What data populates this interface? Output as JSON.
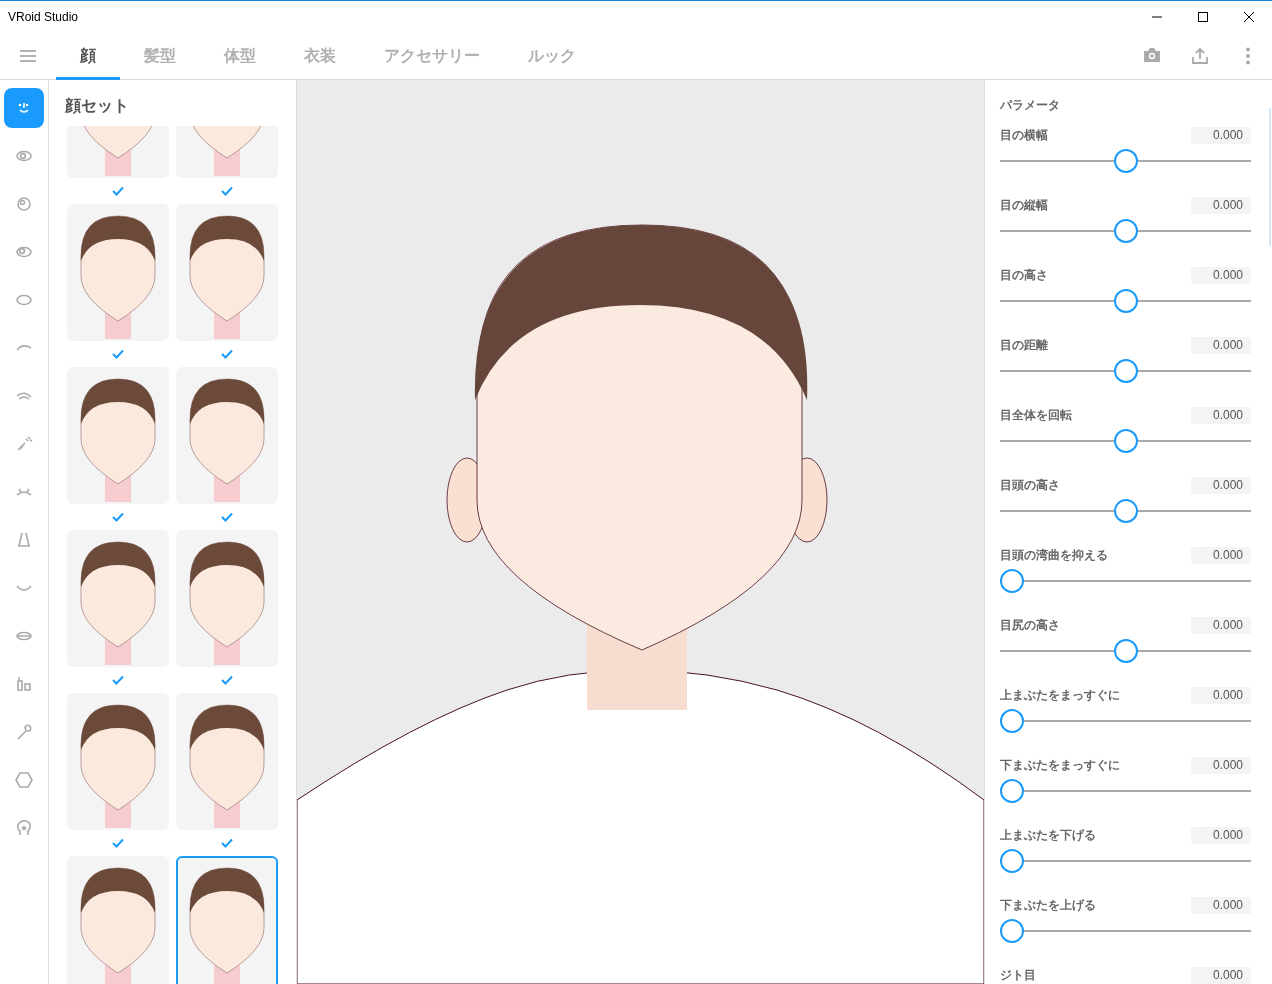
{
  "window": {
    "title": "VRoid Studio"
  },
  "tabs": [
    {
      "label": "顔",
      "selected": true
    },
    {
      "label": "髪型",
      "selected": false
    },
    {
      "label": "体型",
      "selected": false
    },
    {
      "label": "衣装",
      "selected": false
    },
    {
      "label": "アクセサリー",
      "selected": false
    },
    {
      "label": "ルック",
      "selected": false
    }
  ],
  "sidebar": {
    "items": [
      {
        "selected": true
      },
      {
        "selected": false
      },
      {
        "selected": false
      },
      {
        "selected": false
      },
      {
        "selected": false
      },
      {
        "selected": false
      },
      {
        "selected": false
      },
      {
        "selected": false
      },
      {
        "selected": false
      },
      {
        "selected": false
      },
      {
        "selected": false
      },
      {
        "selected": false
      },
      {
        "selected": false
      },
      {
        "selected": false
      },
      {
        "selected": false
      },
      {
        "selected": false
      }
    ]
  },
  "preset_panel": {
    "title": "顔セット",
    "presets": [
      {
        "selected": false,
        "checked": true
      },
      {
        "selected": false,
        "checked": true
      },
      {
        "selected": false,
        "checked": true
      },
      {
        "selected": false,
        "checked": true
      },
      {
        "selected": false,
        "checked": true
      },
      {
        "selected": false,
        "checked": true
      },
      {
        "selected": false,
        "checked": true
      },
      {
        "selected": false,
        "checked": true
      },
      {
        "selected": false,
        "checked": true
      },
      {
        "selected": false,
        "checked": true
      },
      {
        "selected": false,
        "checked": false
      },
      {
        "selected": true,
        "checked": false
      }
    ]
  },
  "parameters": {
    "title": "パラメータ",
    "items": [
      {
        "label": "目の横幅",
        "value": "0.000",
        "level": 0.5
      },
      {
        "label": "目の縦幅",
        "value": "0.000",
        "level": 0.5
      },
      {
        "label": "目の高さ",
        "value": "0.000",
        "level": 0.5
      },
      {
        "label": "目の距離",
        "value": "0.000",
        "level": 0.5
      },
      {
        "label": "目全体を回転",
        "value": "0.000",
        "level": 0.5
      },
      {
        "label": "目頭の高さ",
        "value": "0.000",
        "level": 0.5
      },
      {
        "label": "目頭の湾曲を抑える",
        "value": "0.000",
        "level": 0
      },
      {
        "label": "目尻の高さ",
        "value": "0.000",
        "level": 0.5
      },
      {
        "label": "上まぶたをまっすぐに",
        "value": "0.000",
        "level": 0
      },
      {
        "label": "下まぶたをまっすぐに",
        "value": "0.000",
        "level": 0
      },
      {
        "label": "上まぶたを下げる",
        "value": "0.000",
        "level": 0
      },
      {
        "label": "下まぶたを上げる",
        "value": "0.000",
        "level": 0
      },
      {
        "label": "ジト目",
        "value": "0.000"
      }
    ]
  }
}
